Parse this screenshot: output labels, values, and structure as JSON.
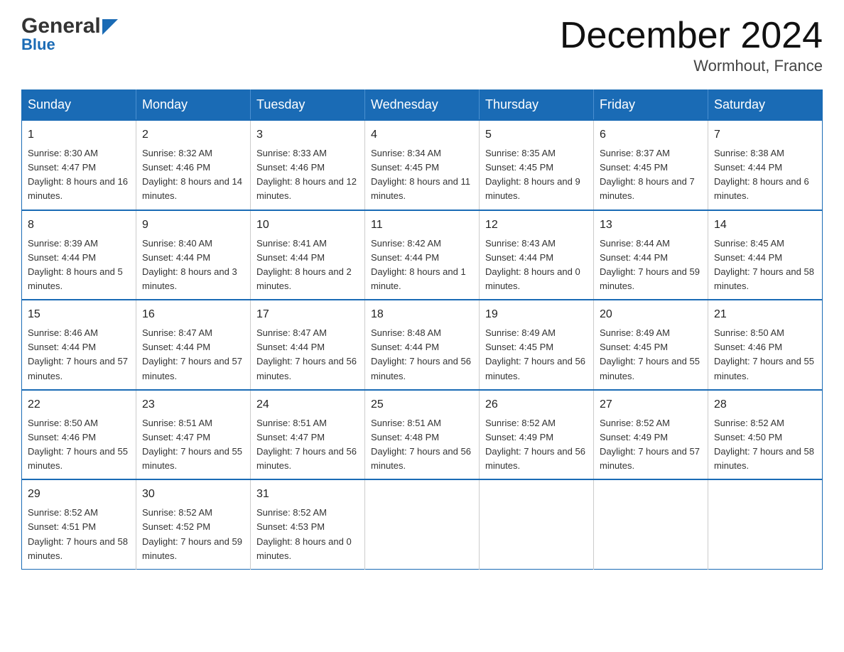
{
  "header": {
    "logo_line1": "General",
    "logo_line2": "Blue",
    "title": "December 2024",
    "subtitle": "Wormhout, France"
  },
  "calendar": {
    "headers": [
      "Sunday",
      "Monday",
      "Tuesday",
      "Wednesday",
      "Thursday",
      "Friday",
      "Saturday"
    ],
    "weeks": [
      [
        {
          "day": "1",
          "sunrise": "Sunrise: 8:30 AM",
          "sunset": "Sunset: 4:47 PM",
          "daylight": "Daylight: 8 hours and 16 minutes."
        },
        {
          "day": "2",
          "sunrise": "Sunrise: 8:32 AM",
          "sunset": "Sunset: 4:46 PM",
          "daylight": "Daylight: 8 hours and 14 minutes."
        },
        {
          "day": "3",
          "sunrise": "Sunrise: 8:33 AM",
          "sunset": "Sunset: 4:46 PM",
          "daylight": "Daylight: 8 hours and 12 minutes."
        },
        {
          "day": "4",
          "sunrise": "Sunrise: 8:34 AM",
          "sunset": "Sunset: 4:45 PM",
          "daylight": "Daylight: 8 hours and 11 minutes."
        },
        {
          "day": "5",
          "sunrise": "Sunrise: 8:35 AM",
          "sunset": "Sunset: 4:45 PM",
          "daylight": "Daylight: 8 hours and 9 minutes."
        },
        {
          "day": "6",
          "sunrise": "Sunrise: 8:37 AM",
          "sunset": "Sunset: 4:45 PM",
          "daylight": "Daylight: 8 hours and 7 minutes."
        },
        {
          "day": "7",
          "sunrise": "Sunrise: 8:38 AM",
          "sunset": "Sunset: 4:44 PM",
          "daylight": "Daylight: 8 hours and 6 minutes."
        }
      ],
      [
        {
          "day": "8",
          "sunrise": "Sunrise: 8:39 AM",
          "sunset": "Sunset: 4:44 PM",
          "daylight": "Daylight: 8 hours and 5 minutes."
        },
        {
          "day": "9",
          "sunrise": "Sunrise: 8:40 AM",
          "sunset": "Sunset: 4:44 PM",
          "daylight": "Daylight: 8 hours and 3 minutes."
        },
        {
          "day": "10",
          "sunrise": "Sunrise: 8:41 AM",
          "sunset": "Sunset: 4:44 PM",
          "daylight": "Daylight: 8 hours and 2 minutes."
        },
        {
          "day": "11",
          "sunrise": "Sunrise: 8:42 AM",
          "sunset": "Sunset: 4:44 PM",
          "daylight": "Daylight: 8 hours and 1 minute."
        },
        {
          "day": "12",
          "sunrise": "Sunrise: 8:43 AM",
          "sunset": "Sunset: 4:44 PM",
          "daylight": "Daylight: 8 hours and 0 minutes."
        },
        {
          "day": "13",
          "sunrise": "Sunrise: 8:44 AM",
          "sunset": "Sunset: 4:44 PM",
          "daylight": "Daylight: 7 hours and 59 minutes."
        },
        {
          "day": "14",
          "sunrise": "Sunrise: 8:45 AM",
          "sunset": "Sunset: 4:44 PM",
          "daylight": "Daylight: 7 hours and 58 minutes."
        }
      ],
      [
        {
          "day": "15",
          "sunrise": "Sunrise: 8:46 AM",
          "sunset": "Sunset: 4:44 PM",
          "daylight": "Daylight: 7 hours and 57 minutes."
        },
        {
          "day": "16",
          "sunrise": "Sunrise: 8:47 AM",
          "sunset": "Sunset: 4:44 PM",
          "daylight": "Daylight: 7 hours and 57 minutes."
        },
        {
          "day": "17",
          "sunrise": "Sunrise: 8:47 AM",
          "sunset": "Sunset: 4:44 PM",
          "daylight": "Daylight: 7 hours and 56 minutes."
        },
        {
          "day": "18",
          "sunrise": "Sunrise: 8:48 AM",
          "sunset": "Sunset: 4:44 PM",
          "daylight": "Daylight: 7 hours and 56 minutes."
        },
        {
          "day": "19",
          "sunrise": "Sunrise: 8:49 AM",
          "sunset": "Sunset: 4:45 PM",
          "daylight": "Daylight: 7 hours and 56 minutes."
        },
        {
          "day": "20",
          "sunrise": "Sunrise: 8:49 AM",
          "sunset": "Sunset: 4:45 PM",
          "daylight": "Daylight: 7 hours and 55 minutes."
        },
        {
          "day": "21",
          "sunrise": "Sunrise: 8:50 AM",
          "sunset": "Sunset: 4:46 PM",
          "daylight": "Daylight: 7 hours and 55 minutes."
        }
      ],
      [
        {
          "day": "22",
          "sunrise": "Sunrise: 8:50 AM",
          "sunset": "Sunset: 4:46 PM",
          "daylight": "Daylight: 7 hours and 55 minutes."
        },
        {
          "day": "23",
          "sunrise": "Sunrise: 8:51 AM",
          "sunset": "Sunset: 4:47 PM",
          "daylight": "Daylight: 7 hours and 55 minutes."
        },
        {
          "day": "24",
          "sunrise": "Sunrise: 8:51 AM",
          "sunset": "Sunset: 4:47 PM",
          "daylight": "Daylight: 7 hours and 56 minutes."
        },
        {
          "day": "25",
          "sunrise": "Sunrise: 8:51 AM",
          "sunset": "Sunset: 4:48 PM",
          "daylight": "Daylight: 7 hours and 56 minutes."
        },
        {
          "day": "26",
          "sunrise": "Sunrise: 8:52 AM",
          "sunset": "Sunset: 4:49 PM",
          "daylight": "Daylight: 7 hours and 56 minutes."
        },
        {
          "day": "27",
          "sunrise": "Sunrise: 8:52 AM",
          "sunset": "Sunset: 4:49 PM",
          "daylight": "Daylight: 7 hours and 57 minutes."
        },
        {
          "day": "28",
          "sunrise": "Sunrise: 8:52 AM",
          "sunset": "Sunset: 4:50 PM",
          "daylight": "Daylight: 7 hours and 58 minutes."
        }
      ],
      [
        {
          "day": "29",
          "sunrise": "Sunrise: 8:52 AM",
          "sunset": "Sunset: 4:51 PM",
          "daylight": "Daylight: 7 hours and 58 minutes."
        },
        {
          "day": "30",
          "sunrise": "Sunrise: 8:52 AM",
          "sunset": "Sunset: 4:52 PM",
          "daylight": "Daylight: 7 hours and 59 minutes."
        },
        {
          "day": "31",
          "sunrise": "Sunrise: 8:52 AM",
          "sunset": "Sunset: 4:53 PM",
          "daylight": "Daylight: 8 hours and 0 minutes."
        },
        {
          "day": "",
          "sunrise": "",
          "sunset": "",
          "daylight": ""
        },
        {
          "day": "",
          "sunrise": "",
          "sunset": "",
          "daylight": ""
        },
        {
          "day": "",
          "sunrise": "",
          "sunset": "",
          "daylight": ""
        },
        {
          "day": "",
          "sunrise": "",
          "sunset": "",
          "daylight": ""
        }
      ]
    ]
  }
}
